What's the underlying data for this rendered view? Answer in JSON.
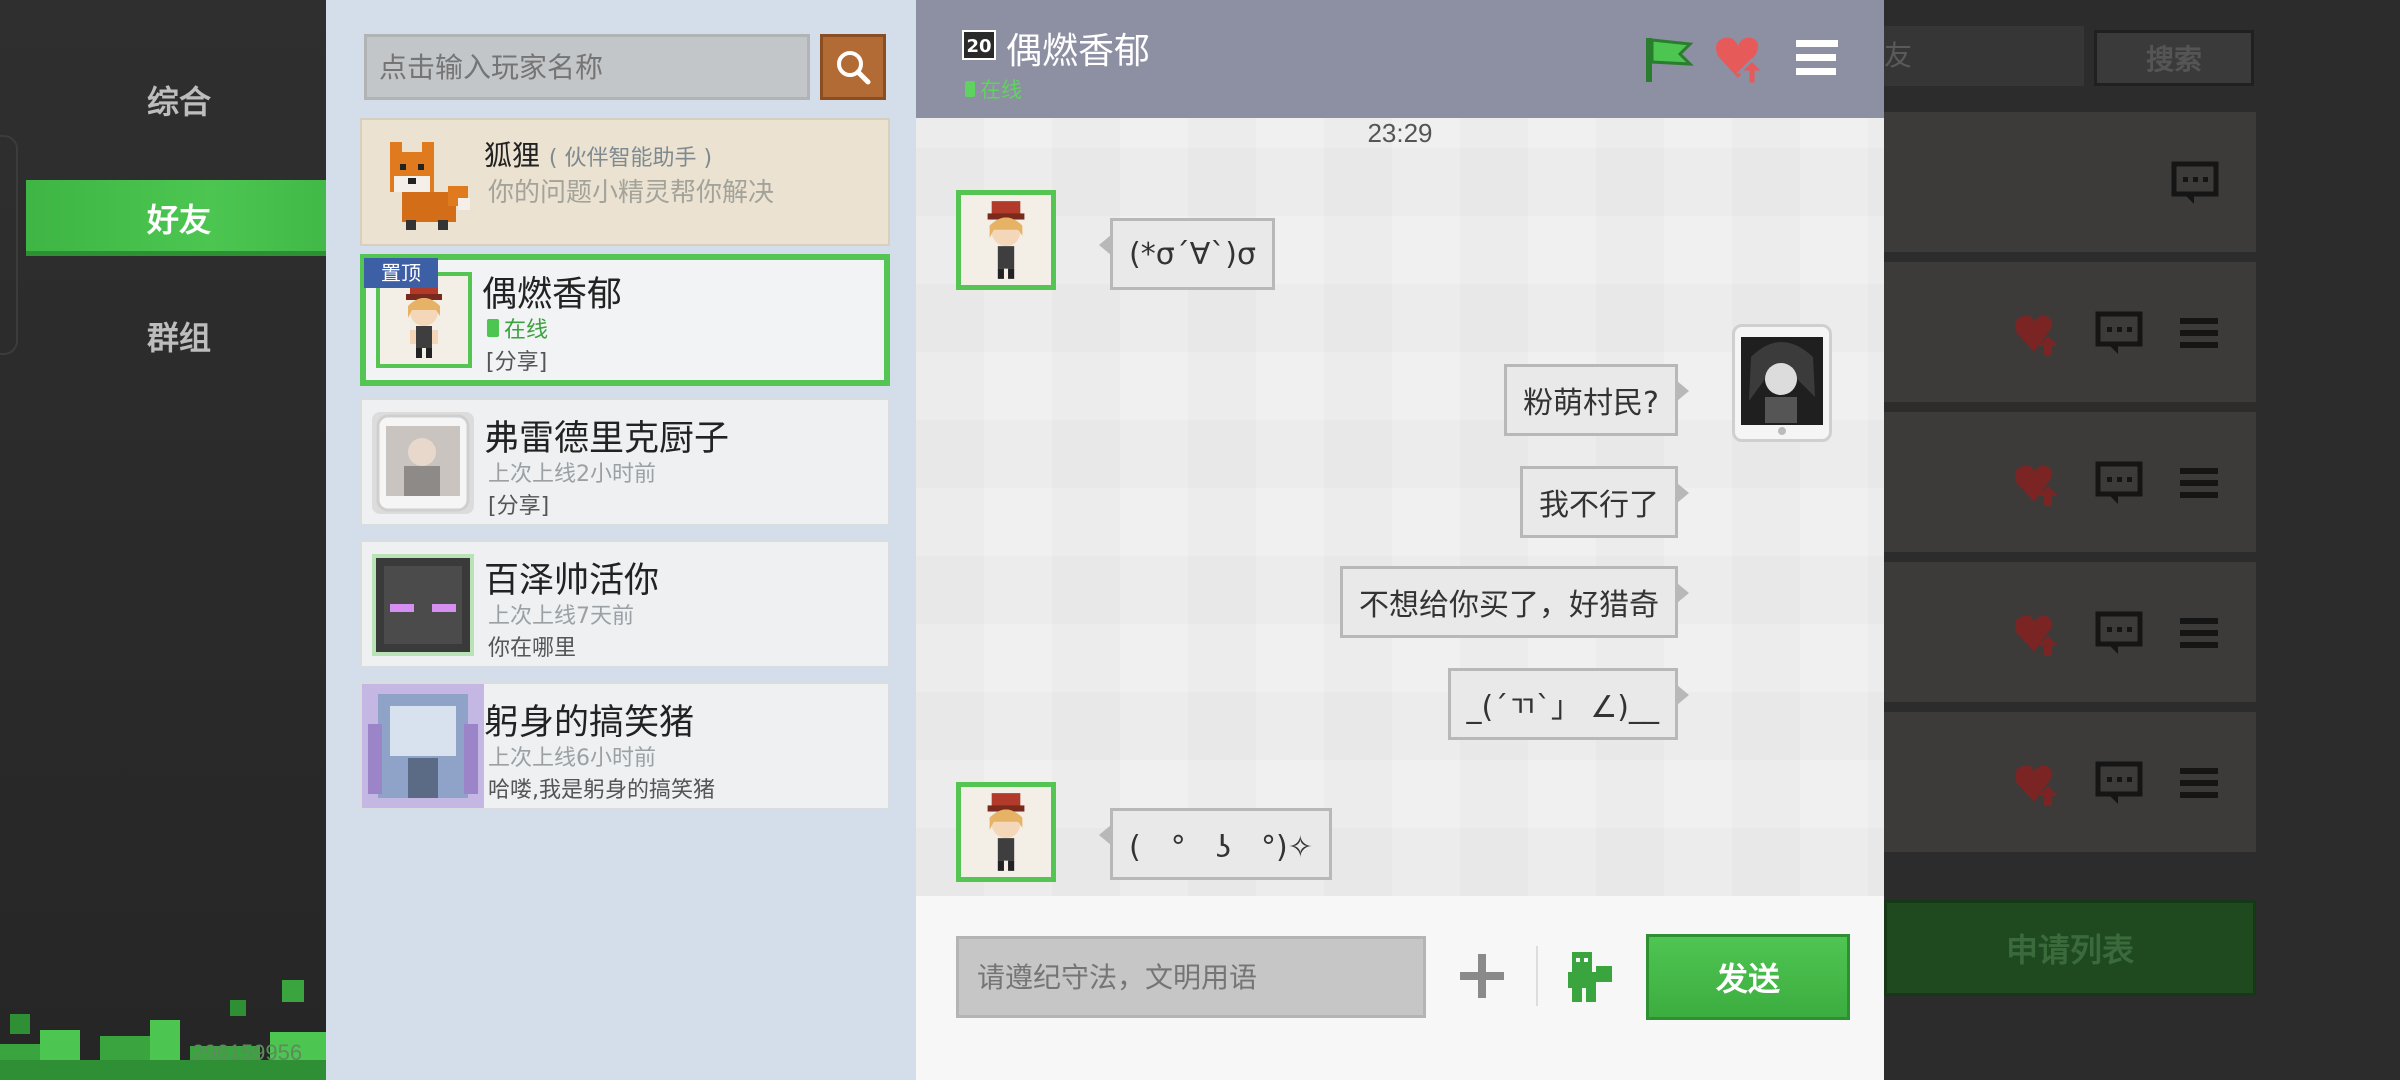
{
  "nav": {
    "items": [
      {
        "label": "综合",
        "active": false
      },
      {
        "label": "好友",
        "active": true
      },
      {
        "label": "群组",
        "active": false
      }
    ],
    "uid": "296159956"
  },
  "friends": {
    "search_placeholder": "点击输入玩家名称",
    "list": [
      {
        "name": "狐狸",
        "tag": "( 伙伴智能助手 )",
        "line2": "你的问题小精灵帮你解决",
        "line3": "",
        "type": "assistant"
      },
      {
        "name": "偶燃香郁",
        "pin": "置顶",
        "line2": "在线",
        "line3": "[分享]",
        "type": "selected"
      },
      {
        "name": "弗雷德里克厨子",
        "line2": "上次上线2小时前",
        "line3": "[分享]",
        "type": "normal"
      },
      {
        "name": "百泽帅活你",
        "line2": "上次上线7天前",
        "line3": "你在哪里",
        "type": "normal"
      },
      {
        "name": "躬身的搞笑猪",
        "line2": "上次上线6小时前",
        "line3": "哈喽,我是躬身的搞笑猪",
        "type": "normal"
      }
    ]
  },
  "chat": {
    "level": "20",
    "title": "偶燃香郁",
    "status": "在线",
    "timestamp": "23:29",
    "messages": [
      {
        "from": "friend",
        "text": "(*σ´∀`)σ"
      },
      {
        "from": "me",
        "text": "粉萌村民?"
      },
      {
        "from": "me",
        "text": "我不行了"
      },
      {
        "from": "me",
        "text": "不想给你买了，好猎奇"
      },
      {
        "from": "me",
        "text": "_(´ㄲ`」 ∠)__"
      },
      {
        "from": "friend",
        "text": "(　°　ʖ　°)✧"
      }
    ],
    "input_placeholder": "请遵纪守法，文明用语",
    "send_label": "发送"
  },
  "right": {
    "search_partial": "友",
    "search_btn": "搜索",
    "apply_label": "申请列表"
  },
  "colors": {
    "accent_green": "#4cc651",
    "header_purple": "#8d8fa2",
    "search_orange": "#b26b35",
    "pin_blue": "#3d5fa6"
  }
}
